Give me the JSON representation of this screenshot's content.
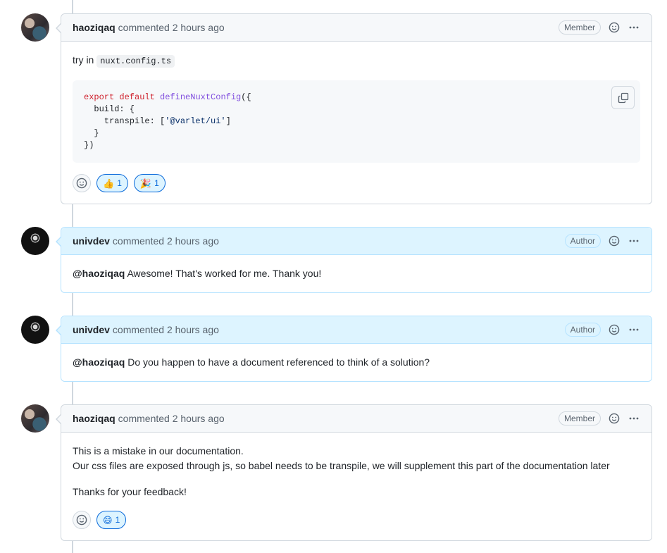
{
  "comments": [
    {
      "user": "haoziqaq",
      "meta": "commented 2 hours ago",
      "role": "Member",
      "body": {
        "prefix": "try in",
        "inline_code": "nuxt.config.ts",
        "code_lines": [
          [
            "export default ",
            "defineNuxtConfig",
            "({"
          ],
          [
            "  build: {"
          ],
          [
            "    transpile: [",
            "'@varlet/ui'",
            "]"
          ],
          [
            "  }"
          ],
          [
            "})"
          ]
        ]
      },
      "reactions": [
        {
          "emoji": "👍",
          "count": "1"
        },
        {
          "emoji": "🎉",
          "count": "1"
        }
      ]
    },
    {
      "user": "univdev",
      "meta": "commented 2 hours ago",
      "role": "Author",
      "mention": "@haoziqaq",
      "text": " Awesome! That's worked for me. Thank you!"
    },
    {
      "user": "univdev",
      "meta": "commented 2 hours ago",
      "role": "Author",
      "mention": "@haoziqaq",
      "text": " Do you happen to have a document referenced to think of a solution?"
    },
    {
      "user": "haoziqaq",
      "meta": "commented 2 hours ago",
      "role": "Member",
      "lines": [
        "This is a mistake in our documentation.",
        "Our css files are exposed through js, so babel needs to be transpile, we will supplement this part of the documentation later"
      ],
      "thanks": "Thanks for your feedback!",
      "reactions": [
        {
          "emoji": "😄",
          "count": "1"
        }
      ]
    }
  ],
  "icons": {
    "smiley": "smiley-icon",
    "kebab": "kebab-horizontal-icon",
    "copy": "copy-icon"
  },
  "colors": {
    "member_header": "#f6f8fa",
    "author_header": "#ddf4ff",
    "reaction_accent": "#0969da"
  }
}
